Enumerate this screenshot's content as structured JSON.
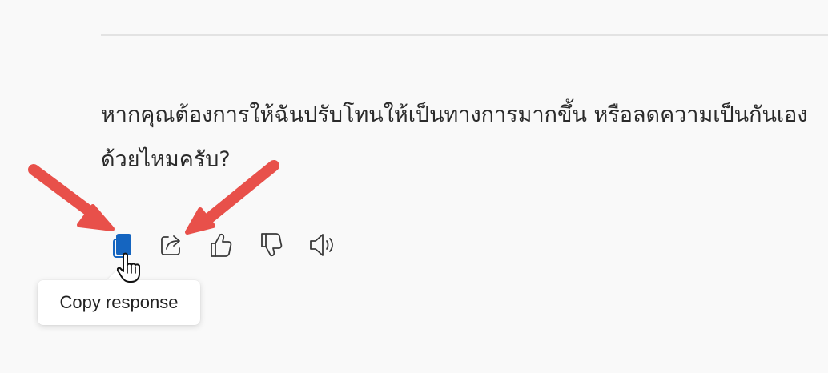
{
  "message": {
    "lines": [
      "หากคุณต้องการให้ฉันปรับโทนให้เป็นทางการมากขึ้น หรือลดความเป็นกันเอง",
      "ด้วยไหมครับ?"
    ]
  },
  "actions": [
    {
      "name": "copy-button",
      "icon": "copy-icon",
      "active": true
    },
    {
      "name": "share-button",
      "icon": "share-icon"
    },
    {
      "name": "like-button",
      "icon": "thumbs-up-icon"
    },
    {
      "name": "dislike-button",
      "icon": "thumbs-down-icon"
    },
    {
      "name": "read-aloud-button",
      "icon": "speaker-icon"
    }
  ],
  "tooltip": {
    "text": "Copy response"
  },
  "colors": {
    "accent": "#1565c0",
    "annotation_arrow": "#e8504a",
    "icon_stroke": "#3a3a3a",
    "text": "#2b2b2b"
  }
}
